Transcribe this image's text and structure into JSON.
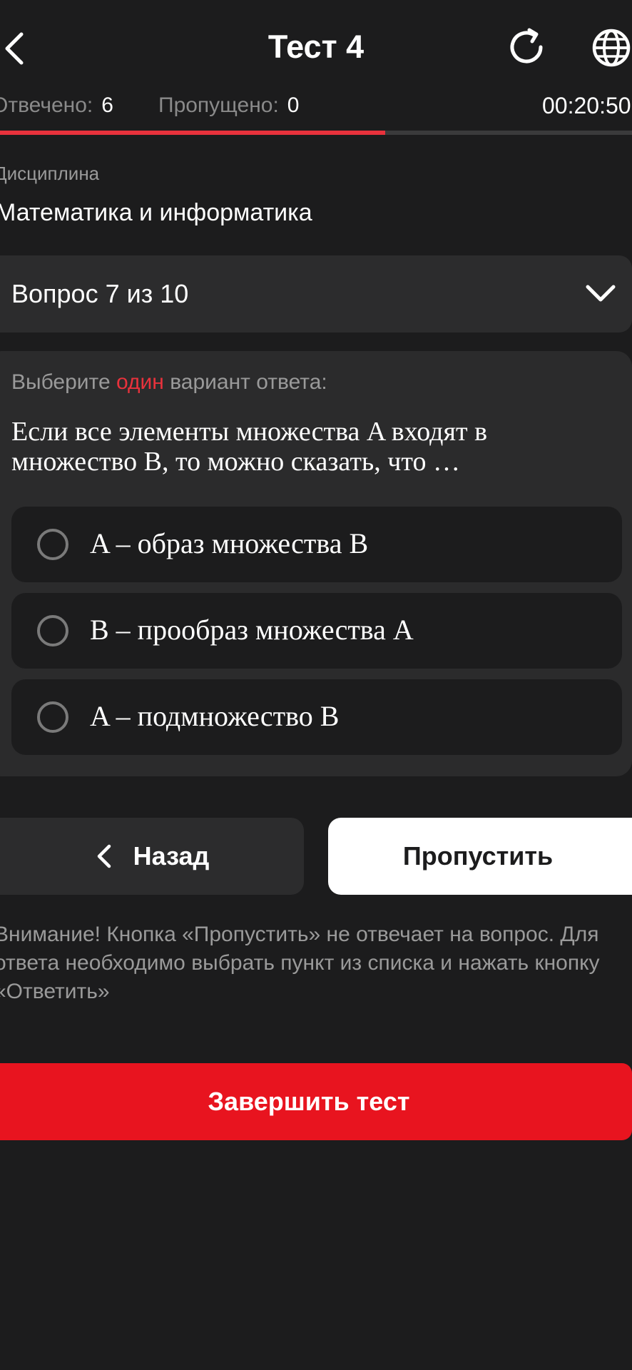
{
  "header": {
    "title": "Тест 4",
    "back_icon": "chevron-left-icon",
    "refresh_icon": "refresh-icon",
    "language_icon": "globe-icon"
  },
  "stats": {
    "answered_label": "Отвечено:",
    "answered_value": "6",
    "skipped_label": "Пропущено:",
    "skipped_value": "0",
    "timer": "00:20:50",
    "progress": 0.61
  },
  "discipline": {
    "label": "Дисциплина",
    "value": "Математика и информатика"
  },
  "question_selector": {
    "label": "Вопрос 7 из 10",
    "icon": "chevron-down-icon"
  },
  "question": {
    "instruction_pre": "Выберите",
    "instruction_accent": "один",
    "instruction_post": "вариант ответа:",
    "text": "Если все элементы множества A входят в множество B, то можно сказать, что …",
    "options": [
      {
        "label": "A – образ множества B"
      },
      {
        "label": "B – прообраз множества A"
      },
      {
        "label": "A – подмножество B"
      }
    ]
  },
  "nav": {
    "back_label": "Назад",
    "skip_label": "Пропустить"
  },
  "warning": "Внимание! Кнопка «Пропустить» не отвечает на вопрос. Для ответа необходимо выбрать пункт из списка и нажать кнопку «Ответить»",
  "finish_label": "Завершить тест",
  "colors": {
    "background": "#1c1c1d",
    "accent": "#e8323c",
    "finish": "#e8141f",
    "card": "#2b2b2c"
  }
}
